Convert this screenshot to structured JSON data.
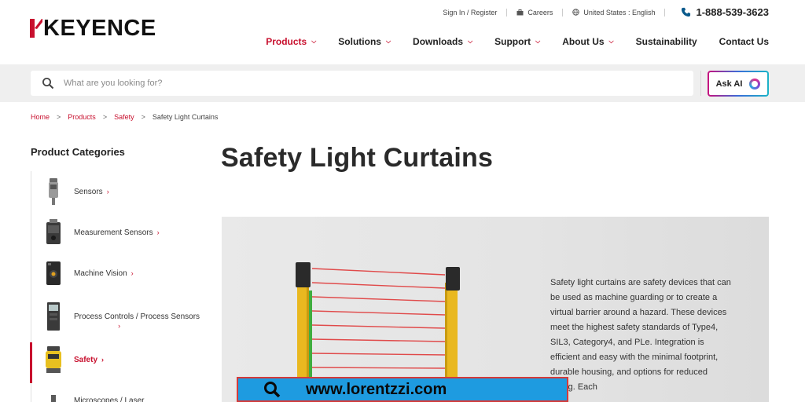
{
  "brand": {
    "name": "KEYENCE",
    "accent": "#c8102e"
  },
  "utility": {
    "sign_in": "Sign In / Register",
    "careers": "Careers",
    "region": "United States : English",
    "phone": "1-888-539-3623"
  },
  "nav": [
    {
      "label": "Products",
      "dropdown": true,
      "active": true
    },
    {
      "label": "Solutions",
      "dropdown": true
    },
    {
      "label": "Downloads",
      "dropdown": true
    },
    {
      "label": "Support",
      "dropdown": true
    },
    {
      "label": "About Us",
      "dropdown": true
    },
    {
      "label": "Sustainability",
      "dropdown": false
    },
    {
      "label": "Contact Us",
      "dropdown": false
    }
  ],
  "search": {
    "placeholder": "What are you looking for?",
    "ask_ai_label": "Ask AI"
  },
  "breadcrumb": [
    "Home",
    "Products",
    "Safety",
    "Safety Light Curtains"
  ],
  "sidebar": {
    "title": "Product Categories",
    "items": [
      {
        "label": "Sensors",
        "icon": "sensor-thumbnail"
      },
      {
        "label": "Measurement Sensors",
        "icon": "measurement-sensor-thumbnail"
      },
      {
        "label": "Machine Vision",
        "icon": "machine-vision-thumbnail"
      },
      {
        "label": "Process Controls / Process Sensors",
        "icon": "process-control-thumbnail"
      },
      {
        "label": "Safety",
        "icon": "safety-thumbnail",
        "active": true
      },
      {
        "label": "Microscopes / Laser",
        "icon": "microscope-thumbnail"
      }
    ]
  },
  "main": {
    "title": "Safety Light Curtains",
    "description": "Safety light curtains are safety devices that can be used as machine guarding or to create a virtual barrier around a hazard. These devices meet the highest safety standards of Type4, SIL3, Category4, and PLe. Integration is efficient and easy with the minimal footprint, durable housing, and options for reduced wiring. Each"
  },
  "watermark": {
    "text": "www.lorentzzi.com"
  }
}
